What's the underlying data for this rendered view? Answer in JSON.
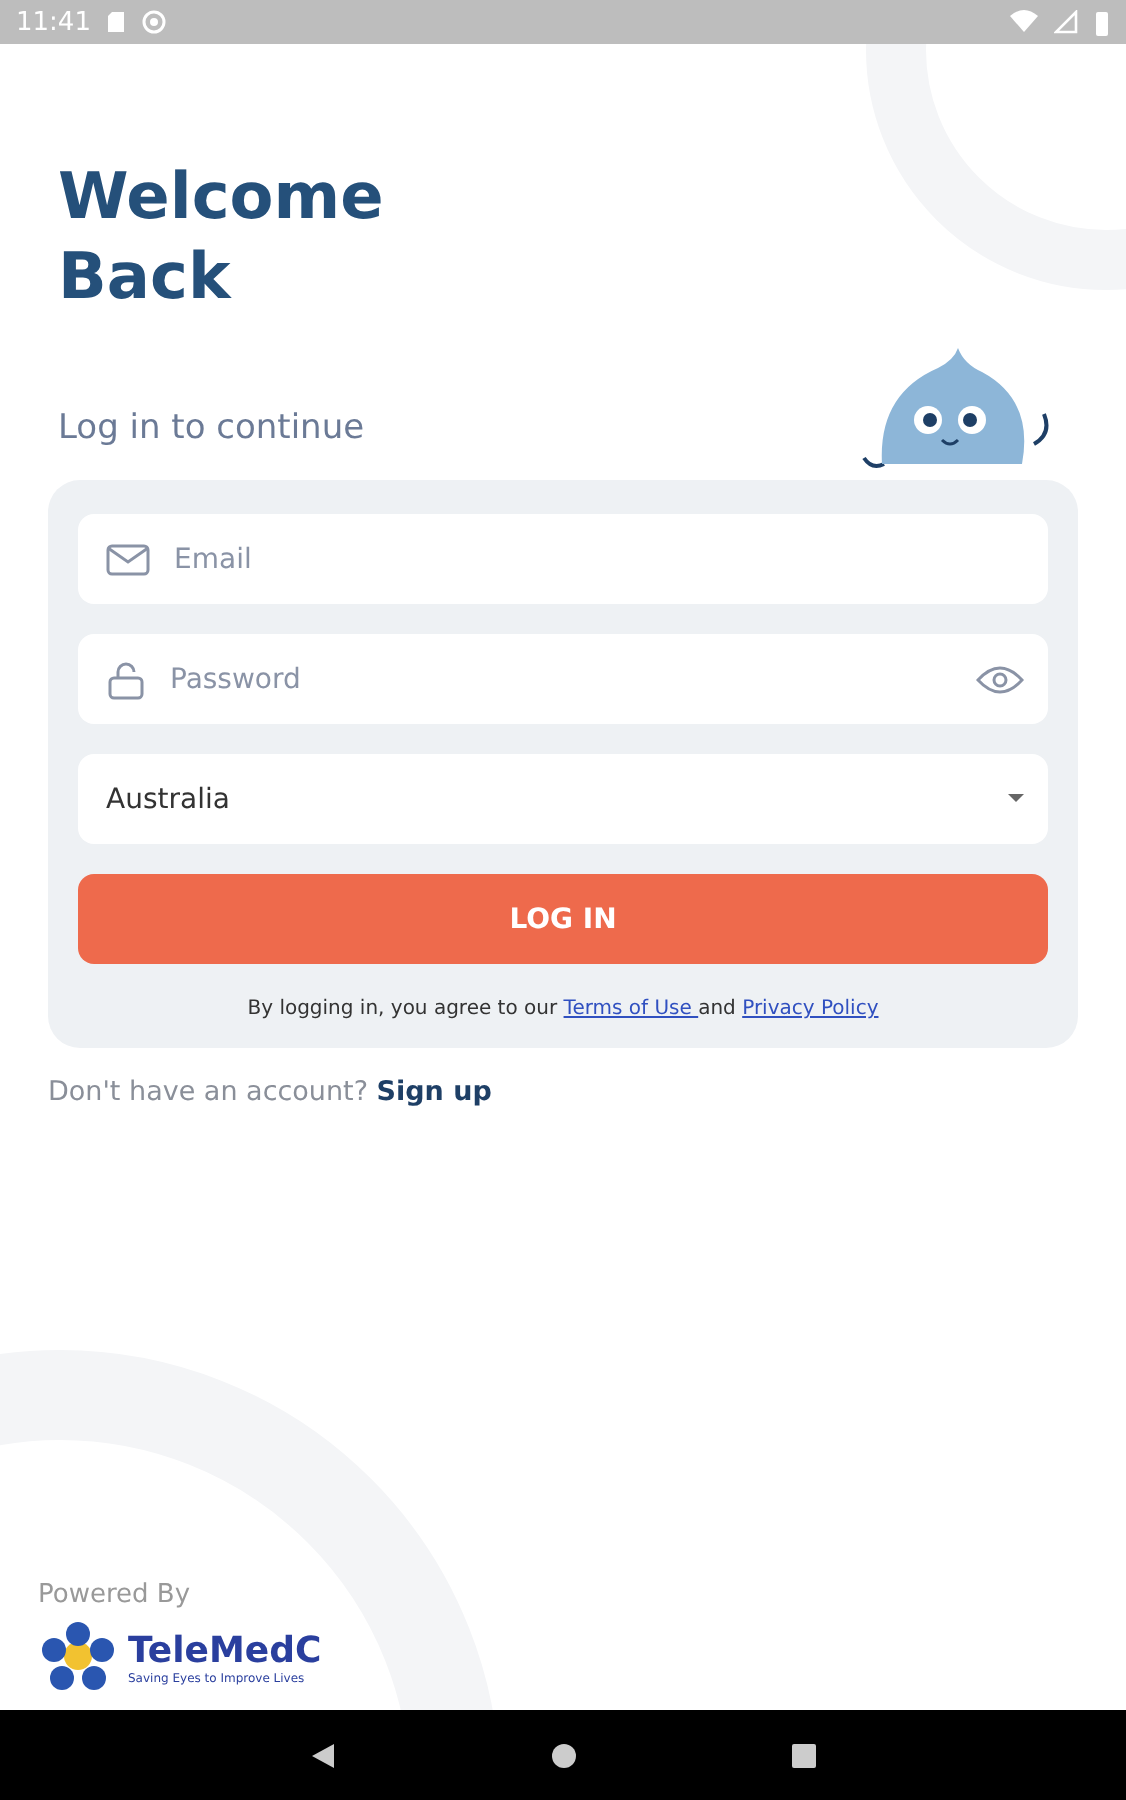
{
  "status_bar": {
    "time": "11:41"
  },
  "title": "Welcome Back",
  "subtitle": "Log in to continue",
  "fields": [
    {
      "kind": "email",
      "placeholder": "Email"
    },
    {
      "kind": "password",
      "placeholder": "Password"
    },
    {
      "kind": "select",
      "value": "Australia"
    }
  ],
  "login_button": "LOG IN",
  "terms": {
    "prefix": "By logging in, you agree to our",
    "terms_link": "Terms of Use ",
    "middle": "and",
    "privacy_link": "Privacy Policy "
  },
  "signup": {
    "prompt": "Don't have an account?",
    "link": "Sign up"
  },
  "footer": {
    "powered_by": "Powered By",
    "brand": "TeleMedC",
    "tagline": "Saving Eyes to Improve Lives"
  }
}
